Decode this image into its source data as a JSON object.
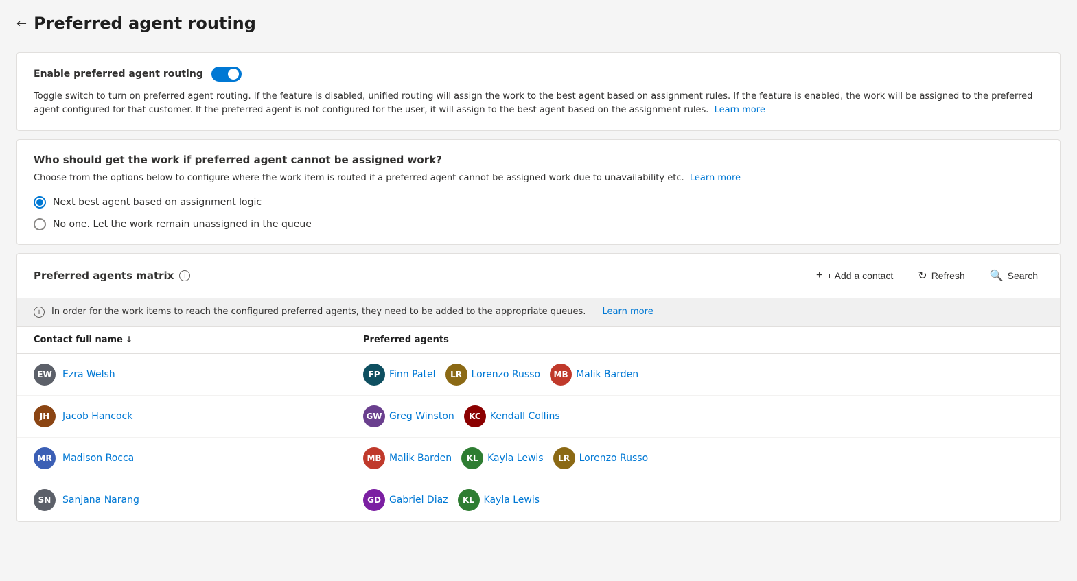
{
  "page": {
    "title": "Preferred agent routing",
    "back_label": "←"
  },
  "enable_section": {
    "label": "Enable preferred agent routing",
    "toggle_on": true,
    "description": "Toggle switch to turn on preferred agent routing. If the feature is disabled, unified routing will assign the work to the best agent based on assignment rules. If the feature is enabled, the work will be assigned to the preferred agent configured for that customer. If the preferred agent is not configured for the user, it will assign to the best agent based on the assignment rules.",
    "learn_more": "Learn more"
  },
  "routing_section": {
    "subtitle": "Who should get the work if preferred agent cannot be assigned work?",
    "description": "Choose from the options below to configure where the work item is routed if a preferred agent cannot be assigned work due to unavailability etc.",
    "learn_more": "Learn more",
    "options": [
      {
        "label": "Next best agent based on assignment logic",
        "selected": true
      },
      {
        "label": "No one. Let the work remain unassigned in the queue",
        "selected": false
      }
    ]
  },
  "matrix": {
    "title": "Preferred agents matrix",
    "info_icon": "i",
    "add_contact_label": "+ Add a contact",
    "refresh_label": "Refresh",
    "search_label": "Search",
    "banner_text": "In order for the work items to reach the configured preferred agents, they need to be added to the appropriate queues.",
    "banner_learn_more": "Learn more",
    "col_contact": "Contact full name",
    "col_agents": "Preferred agents",
    "rows": [
      {
        "contact": {
          "initials": "EW",
          "color": "#5c6069",
          "name": "Ezra Welsh"
        },
        "agents": [
          {
            "initials": "FP",
            "color": "#0e4f60",
            "name": "Finn Patel"
          },
          {
            "initials": "LR",
            "color": "#8b6914",
            "name": "Lorenzo Russo"
          },
          {
            "initials": "MB",
            "color": "#c0392b",
            "name": "Malik Barden"
          }
        ]
      },
      {
        "contact": {
          "initials": "JH",
          "color": "#8b4513",
          "name": "Jacob Hancock"
        },
        "agents": [
          {
            "initials": "GW",
            "color": "#6a3f8e",
            "name": "Greg Winston"
          },
          {
            "initials": "KC",
            "color": "#8b0000",
            "name": "Kendall Collins"
          }
        ]
      },
      {
        "contact": {
          "initials": "MR",
          "color": "#3b5fb5",
          "name": "Madison Rocca"
        },
        "agents": [
          {
            "initials": "MB",
            "color": "#c0392b",
            "name": "Malik Barden"
          },
          {
            "initials": "KL",
            "color": "#2e7d32",
            "name": "Kayla Lewis"
          },
          {
            "initials": "LR",
            "color": "#8b6914",
            "name": "Lorenzo Russo"
          }
        ]
      },
      {
        "contact": {
          "initials": "SN",
          "color": "#5c6069",
          "name": "Sanjana Narang"
        },
        "agents": [
          {
            "initials": "GD",
            "color": "#7b1fa2",
            "name": "Gabriel Diaz"
          },
          {
            "initials": "KL",
            "color": "#2e7d32",
            "name": "Kayla Lewis"
          }
        ]
      }
    ]
  }
}
